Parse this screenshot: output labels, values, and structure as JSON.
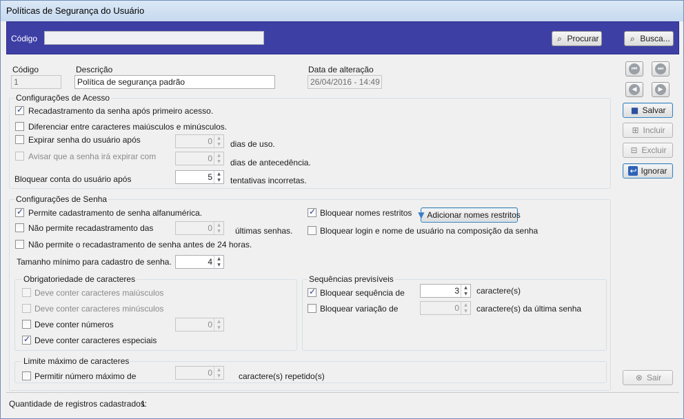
{
  "window": {
    "title": "Políticas de Segurança do Usuário"
  },
  "topbar": {
    "code_label": "Código",
    "code_value": "",
    "search_button": "Procurar",
    "browse_button": "Busca..."
  },
  "header_fields": {
    "code_label": "Código",
    "code_value": "1",
    "description_label": "Descrição",
    "description_value": "Política de segurança padrão",
    "date_label": "Data de alteração",
    "date_value": "26/04/2016 - 14:49"
  },
  "side_buttons": {
    "save": "Salvar",
    "add": "Incluir",
    "delete": "Excluir",
    "ignore": "Ignorar",
    "exit": "Sair"
  },
  "access": {
    "title": "Configurações de Acesso",
    "reregister_first_access": {
      "label": "Recadastramento da senha após primeiro acesso.",
      "checked": true
    },
    "case_sensitive": {
      "label": "Diferenciar entre caracteres maiúsculos e minúsculos.",
      "checked": false
    },
    "expire": {
      "label": "Expirar senha do usuário após",
      "checked": false,
      "value": "0",
      "suffix": "dias de uso."
    },
    "warn": {
      "label": "Avisar que a senha irá expirar com",
      "checked": false,
      "value": "0",
      "suffix": "dias de antecedência."
    },
    "block": {
      "label": "Bloquear conta do usuário após",
      "value": "5",
      "suffix": "tentativas incorretas."
    }
  },
  "password": {
    "title": "Configurações de Senha",
    "alphanumeric": {
      "label": "Permite cadastramento de senha alfanumérica.",
      "checked": true
    },
    "no_reuse": {
      "label": "Não permite recadastramento das",
      "checked": false,
      "value": "0",
      "suffix": "últimas senhas."
    },
    "no_24h": {
      "label": "Não permite o recadastramento de senha antes de 24 horas.",
      "checked": false
    },
    "min_size": {
      "label": "Tamanho mínimo para cadastro de senha.",
      "value": "4"
    },
    "block_names": {
      "label": "Bloquear nomes restritos",
      "checked": true
    },
    "add_restricted_button": "Adicionar nomes restritos",
    "block_login": {
      "label": "Bloquear login e nome de usuário na composição da senha",
      "checked": false
    }
  },
  "required_chars": {
    "title": "Obrigatoriedade de caracteres",
    "upper": {
      "label": "Deve conter caracteres maiúsculos",
      "checked": false
    },
    "lower": {
      "label": "Deve conter caracteres minúsculos",
      "checked": false
    },
    "numbers": {
      "label": "Deve conter números",
      "checked": false,
      "value": "0"
    },
    "special": {
      "label": "Deve conter caracteres especiais",
      "checked": true
    }
  },
  "sequences": {
    "title": "Sequências previsíveis",
    "block_sequence": {
      "label": "Bloquear sequência de",
      "checked": true,
      "value": "3",
      "suffix": "caractere(s)"
    },
    "block_variation": {
      "label": "Bloquear variação de",
      "checked": false,
      "value": "0",
      "suffix": "caractere(s) da última senha"
    }
  },
  "max_limit": {
    "title": "Limite máximo de caracteres",
    "allow_max": {
      "label": "Permitir número máximo de",
      "checked": false,
      "value": "0",
      "suffix": "caractere(s) repetido(s)"
    }
  },
  "status": {
    "label": "Quantidade de registros cadastrados:",
    "count": "1"
  }
}
